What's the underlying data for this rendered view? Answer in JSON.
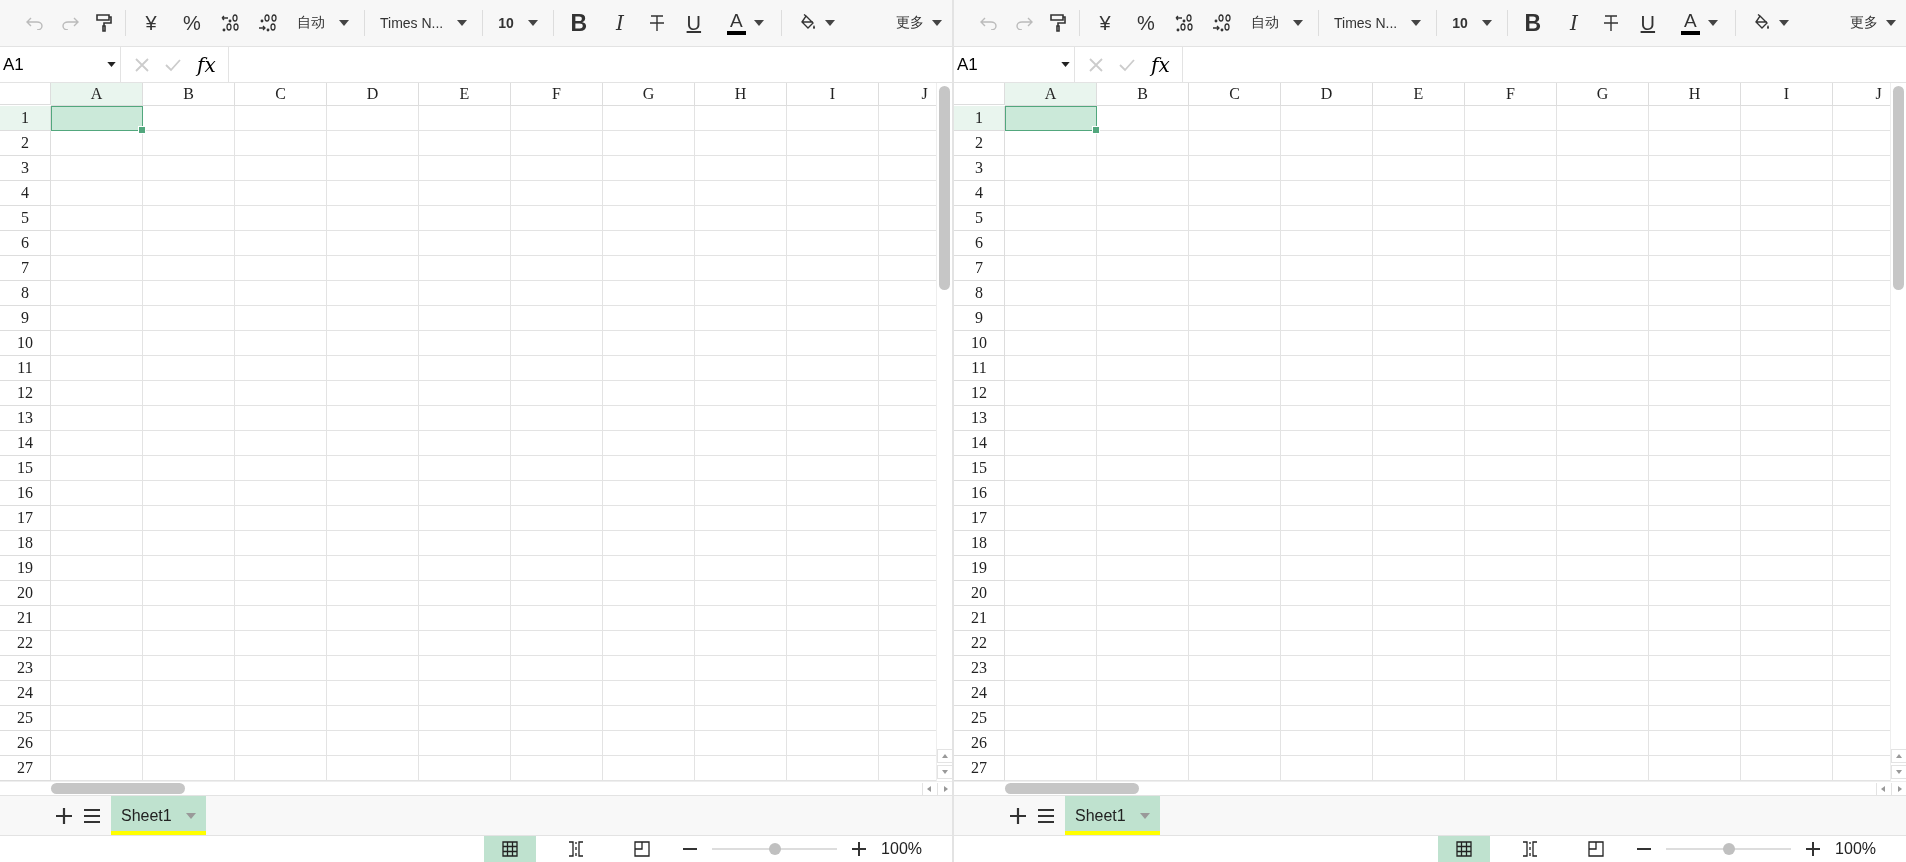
{
  "panes": [
    {
      "toolbar": [
        {
          "kind": "undo",
          "disabled": true
        },
        {
          "kind": "redo",
          "disabled": true
        },
        {
          "kind": "format-painter"
        },
        {
          "kind": "separator"
        },
        {
          "kind": "text",
          "label": "¥"
        },
        {
          "kind": "text",
          "label": "%"
        },
        {
          "kind": "add-decimal"
        },
        {
          "kind": "remove-decimal"
        },
        {
          "kind": "dropdown",
          "value": "自动"
        },
        {
          "kind": "separator"
        },
        {
          "kind": "dropdown",
          "value": "Times N..."
        },
        {
          "kind": "separator"
        },
        {
          "kind": "dropdown",
          "value": "10",
          "bold": true
        },
        {
          "kind": "separator"
        },
        {
          "kind": "bold",
          "label": "B"
        },
        {
          "kind": "italic",
          "label": "I"
        },
        {
          "kind": "strikethrough"
        },
        {
          "kind": "underline",
          "label": "U"
        },
        {
          "kind": "font-color",
          "label": "A"
        },
        {
          "kind": "separator"
        },
        {
          "kind": "fill-color"
        },
        {
          "kind": "more",
          "label": "更多"
        }
      ],
      "name_box": "A1",
      "fx": "fx",
      "columns": [
        {
          "label": "A",
          "selected": true
        },
        {
          "label": "B",
          "selected": false
        },
        {
          "label": "C",
          "selected": false
        },
        {
          "label": "D",
          "selected": false
        },
        {
          "label": "E",
          "selected": false
        },
        {
          "label": "F",
          "selected": false
        },
        {
          "label": "G",
          "selected": false
        },
        {
          "label": "H",
          "selected": false
        },
        {
          "label": "I",
          "selected": false
        },
        {
          "label": "J",
          "selected": false
        }
      ],
      "rows": [
        {
          "label": "1",
          "selected": true
        },
        {
          "label": "2",
          "selected": false
        },
        {
          "label": "3",
          "selected": false
        },
        {
          "label": "4",
          "selected": false
        },
        {
          "label": "5",
          "selected": false
        },
        {
          "label": "6",
          "selected": false
        },
        {
          "label": "7",
          "selected": false
        },
        {
          "label": "8",
          "selected": false
        },
        {
          "label": "9",
          "selected": false
        },
        {
          "label": "10",
          "selected": false
        },
        {
          "label": "11",
          "selected": false
        },
        {
          "label": "12",
          "selected": false
        },
        {
          "label": "13",
          "selected": false
        },
        {
          "label": "14",
          "selected": false
        },
        {
          "label": "15",
          "selected": false
        },
        {
          "label": "16",
          "selected": false
        },
        {
          "label": "17",
          "selected": false
        },
        {
          "label": "18",
          "selected": false
        },
        {
          "label": "19",
          "selected": false
        },
        {
          "label": "20",
          "selected": false
        },
        {
          "label": "21",
          "selected": false
        },
        {
          "label": "22",
          "selected": false
        },
        {
          "label": "23",
          "selected": false
        },
        {
          "label": "24",
          "selected": false
        },
        {
          "label": "25",
          "selected": false
        },
        {
          "label": "26",
          "selected": false
        },
        {
          "label": "27",
          "selected": false
        }
      ],
      "sheet_tabs": [
        {
          "label": "Sheet1",
          "selected": true
        }
      ],
      "views": [
        {
          "kind": "normal",
          "selected": true
        },
        {
          "kind": "page-break",
          "selected": false
        },
        {
          "kind": "page-layout",
          "selected": false
        }
      ],
      "zoom": {
        "level": 0.5,
        "label": "100%"
      }
    },
    {
      "toolbar": [
        {
          "kind": "undo",
          "disabled": true
        },
        {
          "kind": "redo",
          "disabled": true
        },
        {
          "kind": "format-painter"
        },
        {
          "kind": "separator"
        },
        {
          "kind": "text",
          "label": "¥"
        },
        {
          "kind": "text",
          "label": "%"
        },
        {
          "kind": "add-decimal"
        },
        {
          "kind": "remove-decimal"
        },
        {
          "kind": "dropdown",
          "value": "自动"
        },
        {
          "kind": "separator"
        },
        {
          "kind": "dropdown",
          "value": "Times N..."
        },
        {
          "kind": "separator"
        },
        {
          "kind": "dropdown",
          "value": "10",
          "bold": true
        },
        {
          "kind": "separator"
        },
        {
          "kind": "bold",
          "label": "B"
        },
        {
          "kind": "italic",
          "label": "I"
        },
        {
          "kind": "strikethrough"
        },
        {
          "kind": "underline",
          "label": "U"
        },
        {
          "kind": "font-color",
          "label": "A"
        },
        {
          "kind": "separator"
        },
        {
          "kind": "fill-color"
        },
        {
          "kind": "more",
          "label": "更多"
        }
      ],
      "name_box": "A1",
      "fx": "fx",
      "columns": [
        {
          "label": "A",
          "selected": true
        },
        {
          "label": "B",
          "selected": false
        },
        {
          "label": "C",
          "selected": false
        },
        {
          "label": "D",
          "selected": false
        },
        {
          "label": "E",
          "selected": false
        },
        {
          "label": "F",
          "selected": false
        },
        {
          "label": "G",
          "selected": false
        },
        {
          "label": "H",
          "selected": false
        },
        {
          "label": "I",
          "selected": false
        },
        {
          "label": "J",
          "selected": false
        }
      ],
      "rows": [
        {
          "label": "1",
          "selected": true
        },
        {
          "label": "2",
          "selected": false
        },
        {
          "label": "3",
          "selected": false
        },
        {
          "label": "4",
          "selected": false
        },
        {
          "label": "5",
          "selected": false
        },
        {
          "label": "6",
          "selected": false
        },
        {
          "label": "7",
          "selected": false
        },
        {
          "label": "8",
          "selected": false
        },
        {
          "label": "9",
          "selected": false
        },
        {
          "label": "10",
          "selected": false
        },
        {
          "label": "11",
          "selected": false
        },
        {
          "label": "12",
          "selected": false
        },
        {
          "label": "13",
          "selected": false
        },
        {
          "label": "14",
          "selected": false
        },
        {
          "label": "15",
          "selected": false
        },
        {
          "label": "16",
          "selected": false
        },
        {
          "label": "17",
          "selected": false
        },
        {
          "label": "18",
          "selected": false
        },
        {
          "label": "19",
          "selected": false
        },
        {
          "label": "20",
          "selected": false
        },
        {
          "label": "21",
          "selected": false
        },
        {
          "label": "22",
          "selected": false
        },
        {
          "label": "23",
          "selected": false
        },
        {
          "label": "24",
          "selected": false
        },
        {
          "label": "25",
          "selected": false
        },
        {
          "label": "26",
          "selected": false
        },
        {
          "label": "27",
          "selected": false
        }
      ],
      "sheet_tabs": [
        {
          "label": "Sheet1",
          "selected": true
        }
      ],
      "views": [
        {
          "kind": "normal",
          "selected": true
        },
        {
          "kind": "page-break",
          "selected": false
        },
        {
          "kind": "page-layout",
          "selected": false
        }
      ],
      "zoom": {
        "level": 0.5,
        "label": "100%"
      }
    }
  ]
}
